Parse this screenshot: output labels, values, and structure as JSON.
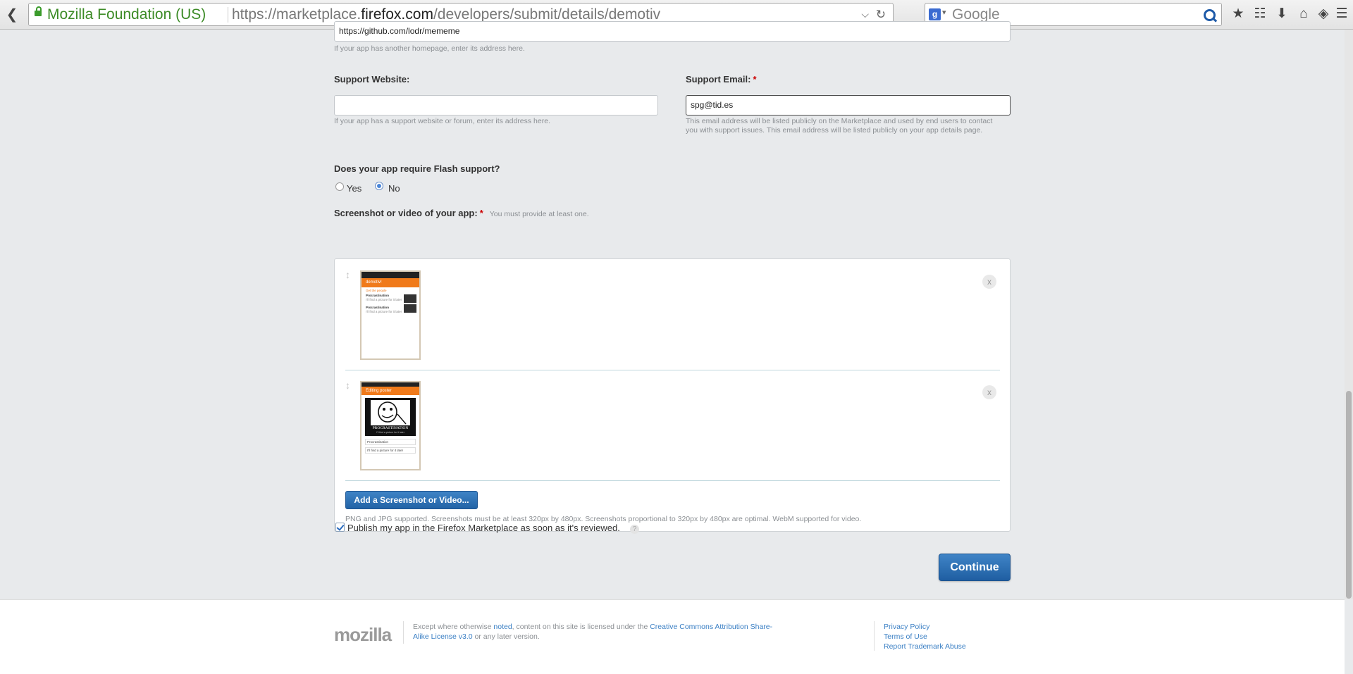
{
  "browser": {
    "identity": "Mozilla Foundation (US)",
    "url_prefix": "https://marketplace.",
    "url_domain": "firefox.com",
    "url_path": "/developers/submit/details/demotiv",
    "search_placeholder": "Google",
    "icons": [
      "back-arrow-icon",
      "lock-icon",
      "dropdown-icon",
      "reload-icon",
      "google-icon",
      "search-icon",
      "star-icon",
      "clipboard-icon",
      "download-icon",
      "home-icon",
      "share-icon",
      "menu-icon"
    ]
  },
  "form": {
    "homepage_value": "https://github.com/lodr/mememe",
    "homepage_hint": "If your app has another homepage, enter its address here.",
    "support_website": {
      "label": "Support Website:",
      "value": "",
      "hint": "If your app has a support website or forum, enter its address here."
    },
    "support_email": {
      "label": "Support Email:",
      "required": "*",
      "value": "spg@tid.es",
      "hint": "This email address will be listed publicly on the Marketplace and used by end users to contact you with support issues. This email address will be listed publicly on your app details page."
    },
    "flash": {
      "question": "Does your app require Flash support?",
      "options": [
        "Yes",
        "No"
      ],
      "selected": "No"
    },
    "screenshots": {
      "label": "Screenshot or video of your app:",
      "required": "*",
      "note": "You must provide at least one.",
      "thumb1": {
        "title": "demotiv!",
        "subtitle": "Get the people",
        "item1": "Procrastination",
        "item2": "Procrastination",
        "item_sub": "I'll find a picture for it later"
      },
      "thumb2": {
        "title": "Editing poster",
        "caption": "PROCRASTINATION",
        "caption_sub": "I'll find a picture for it later",
        "field1": "Procrastination",
        "field2": "I'll find a picture for it later"
      },
      "add_button": "Add a Screenshot or Video...",
      "support_note": "PNG and JPG supported. Screenshots must be at least 320px by 480px. Screenshots proportional to 320px by 480px are optimal. WebM supported for video.",
      "remove_label": "x",
      "drag_label": "↕"
    },
    "publish": {
      "checked": true,
      "label": "Publish my app in the Firefox Marketplace as soon as it's reviewed.",
      "help": "?"
    },
    "continue_button": "Continue"
  },
  "footer": {
    "logo": "mozilla",
    "license_pre": "Except where otherwise ",
    "license_link1": "noted",
    "license_mid": ", content on this site is licensed under the ",
    "license_link2": "Creative Commons Attribution Share-Alike License v3.0",
    "license_post": " or any later version.",
    "links": [
      "Privacy Policy",
      "Terms of Use",
      "Report Trademark Abuse"
    ]
  },
  "colors": {
    "accent": "#2b6fb3",
    "page_bg": "#e8eaec",
    "required": "#cc0000",
    "secure_green": "#3c8b26"
  }
}
